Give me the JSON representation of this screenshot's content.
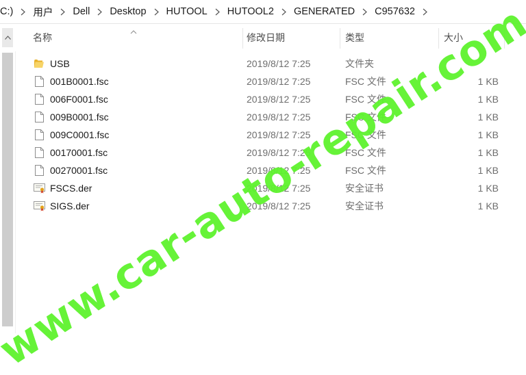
{
  "address": {
    "crumbs": [
      "C:)",
      "用户",
      "Dell",
      "Desktop",
      "HUTOOL",
      "HUTOOL2",
      "GENERATED",
      "C957632"
    ]
  },
  "columns": {
    "name": "名称",
    "date": "修改日期",
    "type": "类型",
    "size": "大小"
  },
  "files": [
    {
      "icon": "folder-icon",
      "name": "USB",
      "date": "2019/8/12 7:25",
      "type": "文件夹",
      "size": ""
    },
    {
      "icon": "file-icon",
      "name": "001B0001.fsc",
      "date": "2019/8/12 7:25",
      "type": "FSC 文件",
      "size": "1 KB"
    },
    {
      "icon": "file-icon",
      "name": "006F0001.fsc",
      "date": "2019/8/12 7:25",
      "type": "FSC 文件",
      "size": "1 KB"
    },
    {
      "icon": "file-icon",
      "name": "009B0001.fsc",
      "date": "2019/8/12 7:25",
      "type": "FSC 文件",
      "size": "1 KB"
    },
    {
      "icon": "file-icon",
      "name": "009C0001.fsc",
      "date": "2019/8/12 7:25",
      "type": "FSC 文件",
      "size": "1 KB"
    },
    {
      "icon": "file-icon",
      "name": "00170001.fsc",
      "date": "2019/8/12 7:25",
      "type": "FSC 文件",
      "size": "1 KB"
    },
    {
      "icon": "file-icon",
      "name": "00270001.fsc",
      "date": "2019/8/12 7:25",
      "type": "FSC 文件",
      "size": "1 KB"
    },
    {
      "icon": "certificate-icon",
      "name": "FSCS.der",
      "date": "2019/8/12 7:25",
      "type": "安全证书",
      "size": "1 KB"
    },
    {
      "icon": "certificate-icon",
      "name": "SIGS.der",
      "date": "2019/8/12 7:25",
      "type": "安全证书",
      "size": "1 KB"
    }
  ],
  "watermark": "www.car-auto-repair.com",
  "colors": {
    "watermark": "#5ef32e",
    "folder": "#f2c744"
  }
}
